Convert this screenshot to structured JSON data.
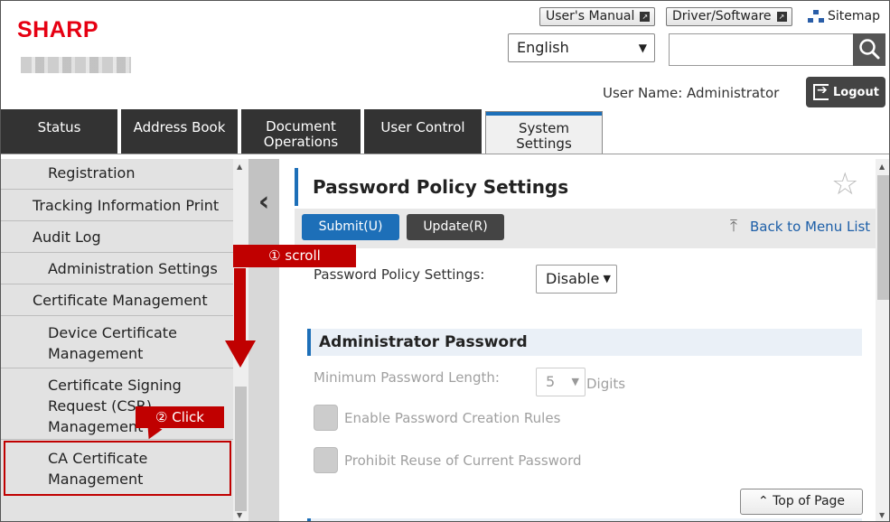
{
  "header": {
    "logo": "SHARP",
    "users_manual": "User's Manual",
    "driver_software": "Driver/Software",
    "sitemap": "Sitemap",
    "language": "English",
    "search_value": "",
    "user_name": "User Name: Administrator",
    "logout": "Logout"
  },
  "tabs": [
    {
      "label": "Status"
    },
    {
      "label": "Address Book"
    },
    {
      "label": "Document\nOperations"
    },
    {
      "label": "User Control"
    },
    {
      "label": "System\nSettings"
    }
  ],
  "sidebar": {
    "items": [
      {
        "label": "Registration"
      },
      {
        "label": "Tracking Information Print"
      },
      {
        "label": "Audit Log"
      },
      {
        "label": "Administration Settings"
      },
      {
        "label": "Certificate Management"
      },
      {
        "label": "Device Certificate\nManagement"
      },
      {
        "label": "Certificate Signing\nRequest (CSR)\nManagement"
      },
      {
        "label": "CA Certificate\nManagement"
      }
    ]
  },
  "main": {
    "title": "Password Policy Settings",
    "submit": "Submit(U)",
    "update": "Update(R)",
    "back": "Back to Menu List",
    "policy_label": "Password Policy Settings:",
    "policy_value": "Disable",
    "section_title": "Administrator Password",
    "min_length_label": "Minimum Password Length:",
    "min_length_value": "5",
    "digits": "Digits",
    "creation_rules": "Enable Password Creation Rules",
    "prohibit_reuse": "Prohibit Reuse of Current Password",
    "top_of_page": "Top of Page"
  },
  "annotations": {
    "scroll": "① scroll",
    "click": "② Click"
  },
  "colors": {
    "brand": "#e60012",
    "accent": "#1d6fb8",
    "annotation": "#c00000"
  }
}
